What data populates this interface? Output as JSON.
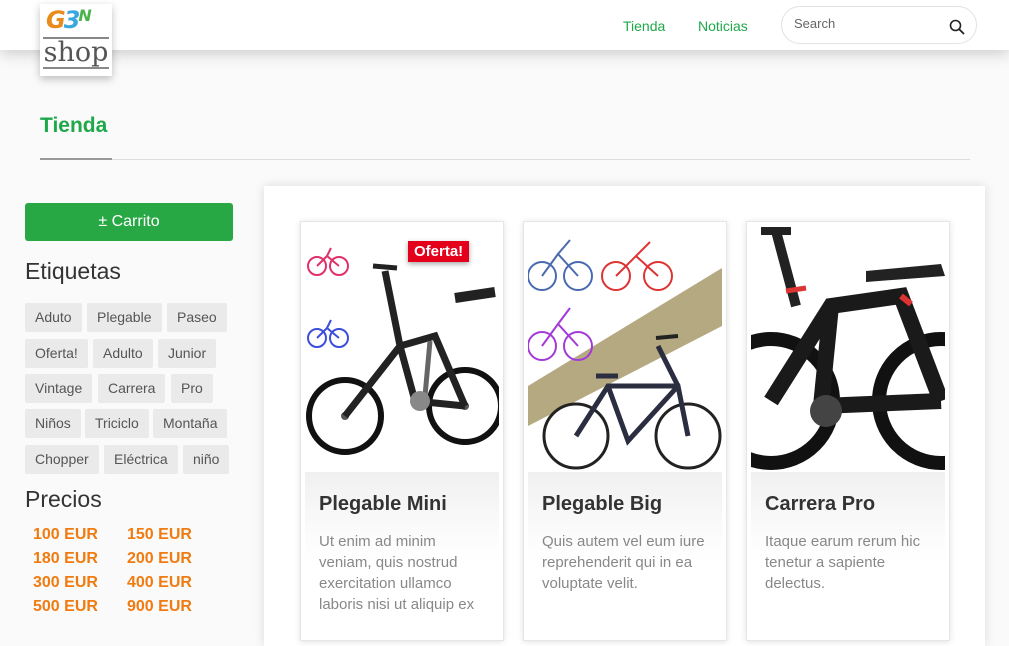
{
  "header": {
    "logo_text": "G3N shop",
    "nav": [
      {
        "label": "Tienda"
      },
      {
        "label": "Noticias"
      }
    ],
    "search": {
      "placeholder": "Search",
      "value": ""
    }
  },
  "page": {
    "title": "Tienda"
  },
  "sidebar": {
    "cart_button": "± Carrito",
    "tags_heading": "Etiquetas",
    "tags": [
      "Aduto",
      "Plegable",
      "Paseo",
      "Oferta!",
      "Adulto",
      "Junior",
      "Vintage",
      "Carrera",
      "Pro",
      "Niños",
      "Triciclo",
      "Montaña",
      "Chopper",
      "Eléctrica",
      "niño"
    ],
    "prices_heading": "Precios",
    "prices": [
      "100 EUR",
      "150 EUR",
      "180 EUR",
      "200 EUR",
      "300 EUR",
      "400 EUR",
      "500 EUR",
      "900 EUR"
    ]
  },
  "products": [
    {
      "title": "Plegable Mini",
      "badge": "Oferta!",
      "description": "Ut enim ad minim veniam, quis nostrud exercitation ullamco laboris nisi ut aliquip ex"
    },
    {
      "title": "Plegable Big",
      "badge": "",
      "description": "Quis autem vel eum iure reprehenderit qui in ea voluptate velit."
    },
    {
      "title": "Carrera Pro",
      "badge": "",
      "description": "Itaque earum rerum hic tenetur a sapiente delectus."
    }
  ],
  "colors": {
    "accent": "#1ea84a",
    "button": "#28a745",
    "price": "#f07b10",
    "badge": "#e4001b"
  },
  "icons": {
    "search": "search-icon",
    "logo": "g3n-shop-logo"
  }
}
